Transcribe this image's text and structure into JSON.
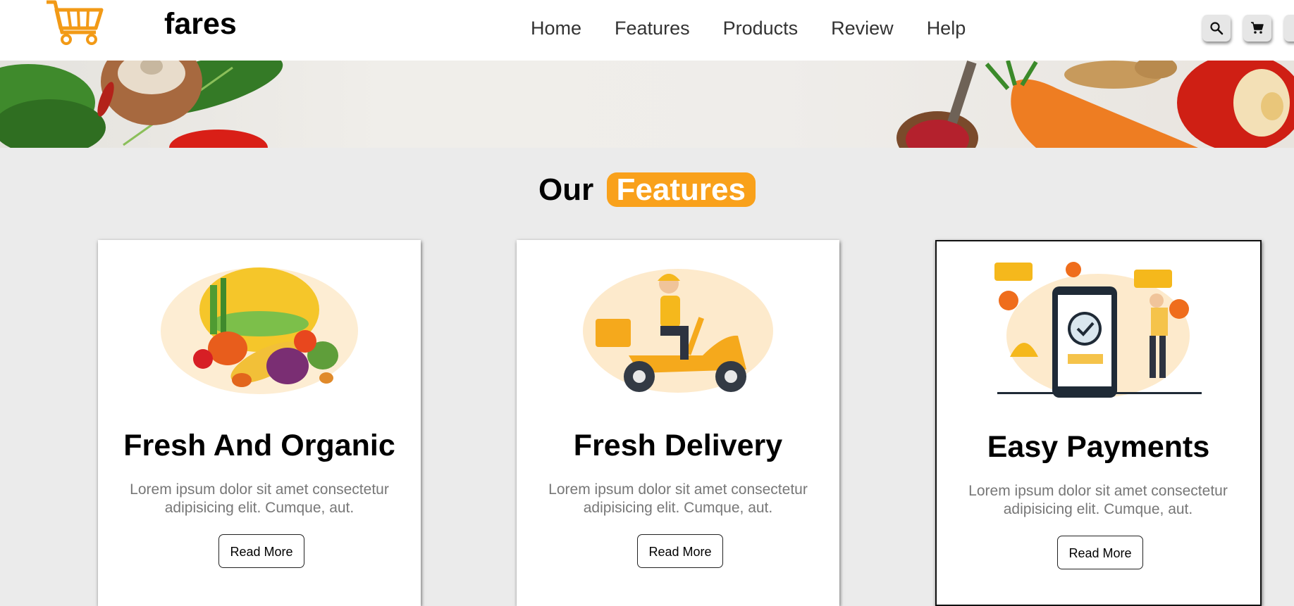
{
  "header": {
    "brand": "fares",
    "nav": [
      "Home",
      "Features",
      "Products",
      "Review",
      "Help"
    ]
  },
  "features": {
    "title_prefix": "Our",
    "title_highlight": "Features",
    "cards": [
      {
        "title": "Fresh And Organic",
        "text": "Lorem ipsum dolor sit amet consectetur adipisicing elit. Cumque, aut.",
        "button": "Read More",
        "icon": "vegetables-illustration"
      },
      {
        "title": "Fresh Delivery",
        "text": "Lorem ipsum dolor sit amet consectetur adipisicing elit. Cumque, aut.",
        "button": "Read More",
        "icon": "delivery-scooter-illustration"
      },
      {
        "title": "Easy Payments",
        "text": "Lorem ipsum dolor sit amet consectetur adipisicing elit. Cumque, aut.",
        "button": "Read More",
        "icon": "mobile-payment-illustration"
      }
    ]
  },
  "colors": {
    "accent": "#f9a11b",
    "page_background": "#ebebeb"
  }
}
